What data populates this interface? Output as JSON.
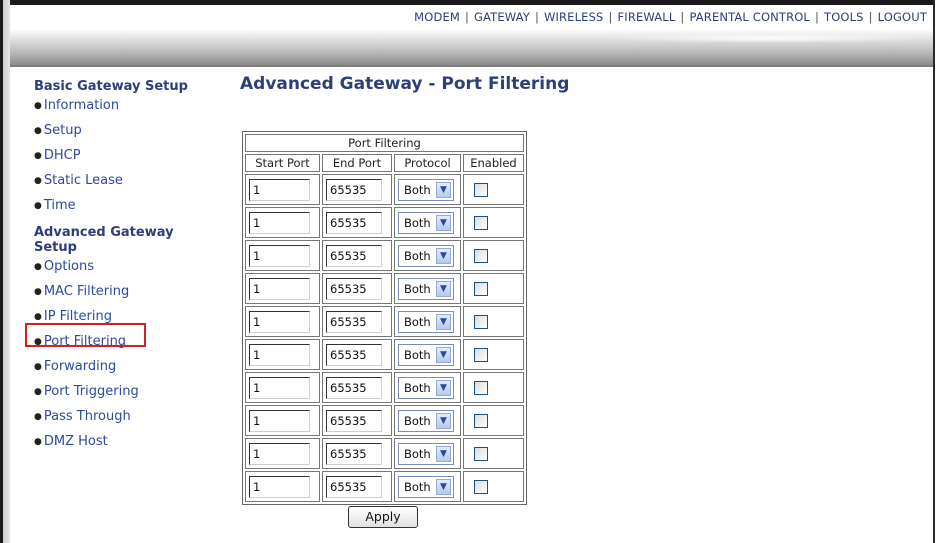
{
  "nav": {
    "items": [
      "MODEM",
      "GATEWAY",
      "WIRELESS",
      "FIREWALL",
      "PARENTAL CONTROL",
      "TOOLS",
      "LOGOUT"
    ],
    "separator": "|"
  },
  "sidebar": {
    "basic_heading": "Basic Gateway Setup",
    "basic_items": [
      "Information",
      "Setup",
      "DHCP",
      "Static Lease",
      "Time"
    ],
    "advanced_heading_line1": "Advanced Gateway",
    "advanced_heading_line2": "Setup",
    "advanced_items": [
      "Options",
      "MAC Filtering",
      "IP Filtering",
      "Port Filtering",
      "Forwarding",
      "Port Triggering",
      "Pass Through",
      "DMZ Host"
    ],
    "highlighted_item": "Port Filtering",
    "highlight_color": "#d42020"
  },
  "page": {
    "title": "Advanced Gateway - Port Filtering"
  },
  "table": {
    "caption": "Port Filtering",
    "headers": [
      "Start Port",
      "End Port",
      "Protocol",
      "Enabled"
    ],
    "rows": [
      {
        "start": "1",
        "end": "65535",
        "protocol": "Both",
        "enabled": false
      },
      {
        "start": "1",
        "end": "65535",
        "protocol": "Both",
        "enabled": false
      },
      {
        "start": "1",
        "end": "65535",
        "protocol": "Both",
        "enabled": false
      },
      {
        "start": "1",
        "end": "65535",
        "protocol": "Both",
        "enabled": false
      },
      {
        "start": "1",
        "end": "65535",
        "protocol": "Both",
        "enabled": false
      },
      {
        "start": "1",
        "end": "65535",
        "protocol": "Both",
        "enabled": false
      },
      {
        "start": "1",
        "end": "65535",
        "protocol": "Both",
        "enabled": false
      },
      {
        "start": "1",
        "end": "65535",
        "protocol": "Both",
        "enabled": false
      },
      {
        "start": "1",
        "end": "65535",
        "protocol": "Both",
        "enabled": false
      },
      {
        "start": "1",
        "end": "65535",
        "protocol": "Both",
        "enabled": false
      }
    ]
  },
  "apply_label": "Apply",
  "colors": {
    "heading": "#2d3f7a",
    "link": "#2d4aa0"
  }
}
